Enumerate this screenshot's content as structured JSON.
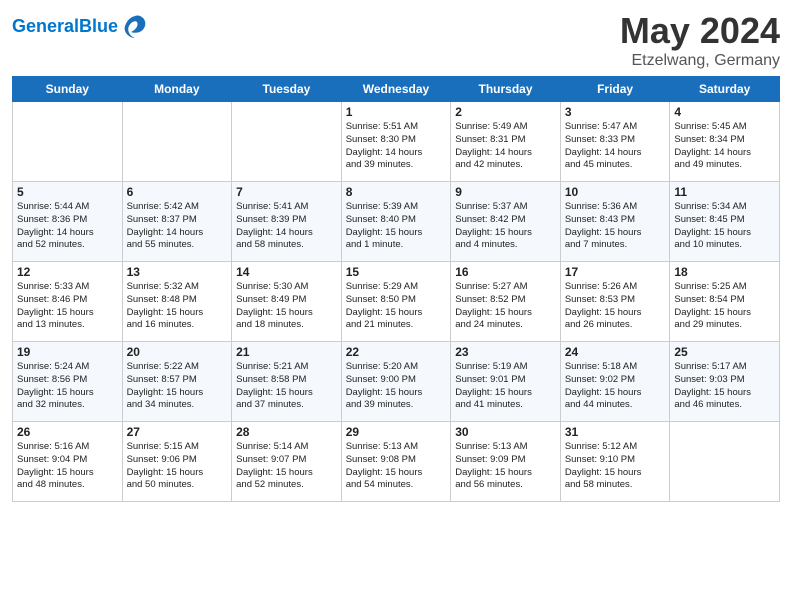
{
  "header": {
    "logo_line1": "General",
    "logo_line2": "Blue",
    "month": "May 2024",
    "location": "Etzelwang, Germany"
  },
  "days_of_week": [
    "Sunday",
    "Monday",
    "Tuesday",
    "Wednesday",
    "Thursday",
    "Friday",
    "Saturday"
  ],
  "weeks": [
    [
      {
        "day": "",
        "info": ""
      },
      {
        "day": "",
        "info": ""
      },
      {
        "day": "",
        "info": ""
      },
      {
        "day": "1",
        "info": "Sunrise: 5:51 AM\nSunset: 8:30 PM\nDaylight: 14 hours\nand 39 minutes."
      },
      {
        "day": "2",
        "info": "Sunrise: 5:49 AM\nSunset: 8:31 PM\nDaylight: 14 hours\nand 42 minutes."
      },
      {
        "day": "3",
        "info": "Sunrise: 5:47 AM\nSunset: 8:33 PM\nDaylight: 14 hours\nand 45 minutes."
      },
      {
        "day": "4",
        "info": "Sunrise: 5:45 AM\nSunset: 8:34 PM\nDaylight: 14 hours\nand 49 minutes."
      }
    ],
    [
      {
        "day": "5",
        "info": "Sunrise: 5:44 AM\nSunset: 8:36 PM\nDaylight: 14 hours\nand 52 minutes."
      },
      {
        "day": "6",
        "info": "Sunrise: 5:42 AM\nSunset: 8:37 PM\nDaylight: 14 hours\nand 55 minutes."
      },
      {
        "day": "7",
        "info": "Sunrise: 5:41 AM\nSunset: 8:39 PM\nDaylight: 14 hours\nand 58 minutes."
      },
      {
        "day": "8",
        "info": "Sunrise: 5:39 AM\nSunset: 8:40 PM\nDaylight: 15 hours\nand 1 minute."
      },
      {
        "day": "9",
        "info": "Sunrise: 5:37 AM\nSunset: 8:42 PM\nDaylight: 15 hours\nand 4 minutes."
      },
      {
        "day": "10",
        "info": "Sunrise: 5:36 AM\nSunset: 8:43 PM\nDaylight: 15 hours\nand 7 minutes."
      },
      {
        "day": "11",
        "info": "Sunrise: 5:34 AM\nSunset: 8:45 PM\nDaylight: 15 hours\nand 10 minutes."
      }
    ],
    [
      {
        "day": "12",
        "info": "Sunrise: 5:33 AM\nSunset: 8:46 PM\nDaylight: 15 hours\nand 13 minutes."
      },
      {
        "day": "13",
        "info": "Sunrise: 5:32 AM\nSunset: 8:48 PM\nDaylight: 15 hours\nand 16 minutes."
      },
      {
        "day": "14",
        "info": "Sunrise: 5:30 AM\nSunset: 8:49 PM\nDaylight: 15 hours\nand 18 minutes."
      },
      {
        "day": "15",
        "info": "Sunrise: 5:29 AM\nSunset: 8:50 PM\nDaylight: 15 hours\nand 21 minutes."
      },
      {
        "day": "16",
        "info": "Sunrise: 5:27 AM\nSunset: 8:52 PM\nDaylight: 15 hours\nand 24 minutes."
      },
      {
        "day": "17",
        "info": "Sunrise: 5:26 AM\nSunset: 8:53 PM\nDaylight: 15 hours\nand 26 minutes."
      },
      {
        "day": "18",
        "info": "Sunrise: 5:25 AM\nSunset: 8:54 PM\nDaylight: 15 hours\nand 29 minutes."
      }
    ],
    [
      {
        "day": "19",
        "info": "Sunrise: 5:24 AM\nSunset: 8:56 PM\nDaylight: 15 hours\nand 32 minutes."
      },
      {
        "day": "20",
        "info": "Sunrise: 5:22 AM\nSunset: 8:57 PM\nDaylight: 15 hours\nand 34 minutes."
      },
      {
        "day": "21",
        "info": "Sunrise: 5:21 AM\nSunset: 8:58 PM\nDaylight: 15 hours\nand 37 minutes."
      },
      {
        "day": "22",
        "info": "Sunrise: 5:20 AM\nSunset: 9:00 PM\nDaylight: 15 hours\nand 39 minutes."
      },
      {
        "day": "23",
        "info": "Sunrise: 5:19 AM\nSunset: 9:01 PM\nDaylight: 15 hours\nand 41 minutes."
      },
      {
        "day": "24",
        "info": "Sunrise: 5:18 AM\nSunset: 9:02 PM\nDaylight: 15 hours\nand 44 minutes."
      },
      {
        "day": "25",
        "info": "Sunrise: 5:17 AM\nSunset: 9:03 PM\nDaylight: 15 hours\nand 46 minutes."
      }
    ],
    [
      {
        "day": "26",
        "info": "Sunrise: 5:16 AM\nSunset: 9:04 PM\nDaylight: 15 hours\nand 48 minutes."
      },
      {
        "day": "27",
        "info": "Sunrise: 5:15 AM\nSunset: 9:06 PM\nDaylight: 15 hours\nand 50 minutes."
      },
      {
        "day": "28",
        "info": "Sunrise: 5:14 AM\nSunset: 9:07 PM\nDaylight: 15 hours\nand 52 minutes."
      },
      {
        "day": "29",
        "info": "Sunrise: 5:13 AM\nSunset: 9:08 PM\nDaylight: 15 hours\nand 54 minutes."
      },
      {
        "day": "30",
        "info": "Sunrise: 5:13 AM\nSunset: 9:09 PM\nDaylight: 15 hours\nand 56 minutes."
      },
      {
        "day": "31",
        "info": "Sunrise: 5:12 AM\nSunset: 9:10 PM\nDaylight: 15 hours\nand 58 minutes."
      },
      {
        "day": "",
        "info": ""
      }
    ]
  ]
}
